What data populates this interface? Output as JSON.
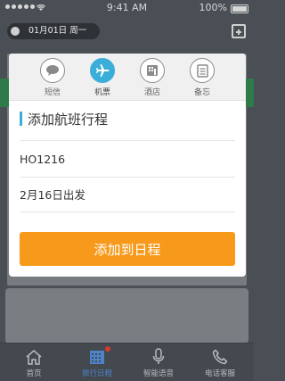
{
  "status_bar": {
    "time": "9:41 AM",
    "battery": "100%"
  },
  "header": {
    "date": "01月01日 周一"
  },
  "modal": {
    "tabs": [
      {
        "label": "短信",
        "icon": "chat-bubble-icon",
        "active": false
      },
      {
        "label": "机票",
        "icon": "airplane-icon",
        "active": true
      },
      {
        "label": "酒店",
        "icon": "hotel-building-icon",
        "active": false
      },
      {
        "label": "备忘",
        "icon": "memo-icon",
        "active": false
      }
    ],
    "title": "添加航班行程",
    "flight_number": "HO1216",
    "departure": "2月16日出发",
    "add_button": "添加到日程"
  },
  "bottom_nav": [
    {
      "label": "首页",
      "icon": "home-icon",
      "active": false
    },
    {
      "label": "旅行日程",
      "icon": "calendar-grid-icon",
      "active": true
    },
    {
      "label": "智能语音",
      "icon": "microphone-icon",
      "active": false
    },
    {
      "label": "电话客服",
      "icon": "phone-icon",
      "active": false
    }
  ],
  "colors": {
    "accent": "#3aaed8",
    "button": "#f79a1c",
    "nav_active": "#4e83c8",
    "badge": "#d83a2d"
  }
}
